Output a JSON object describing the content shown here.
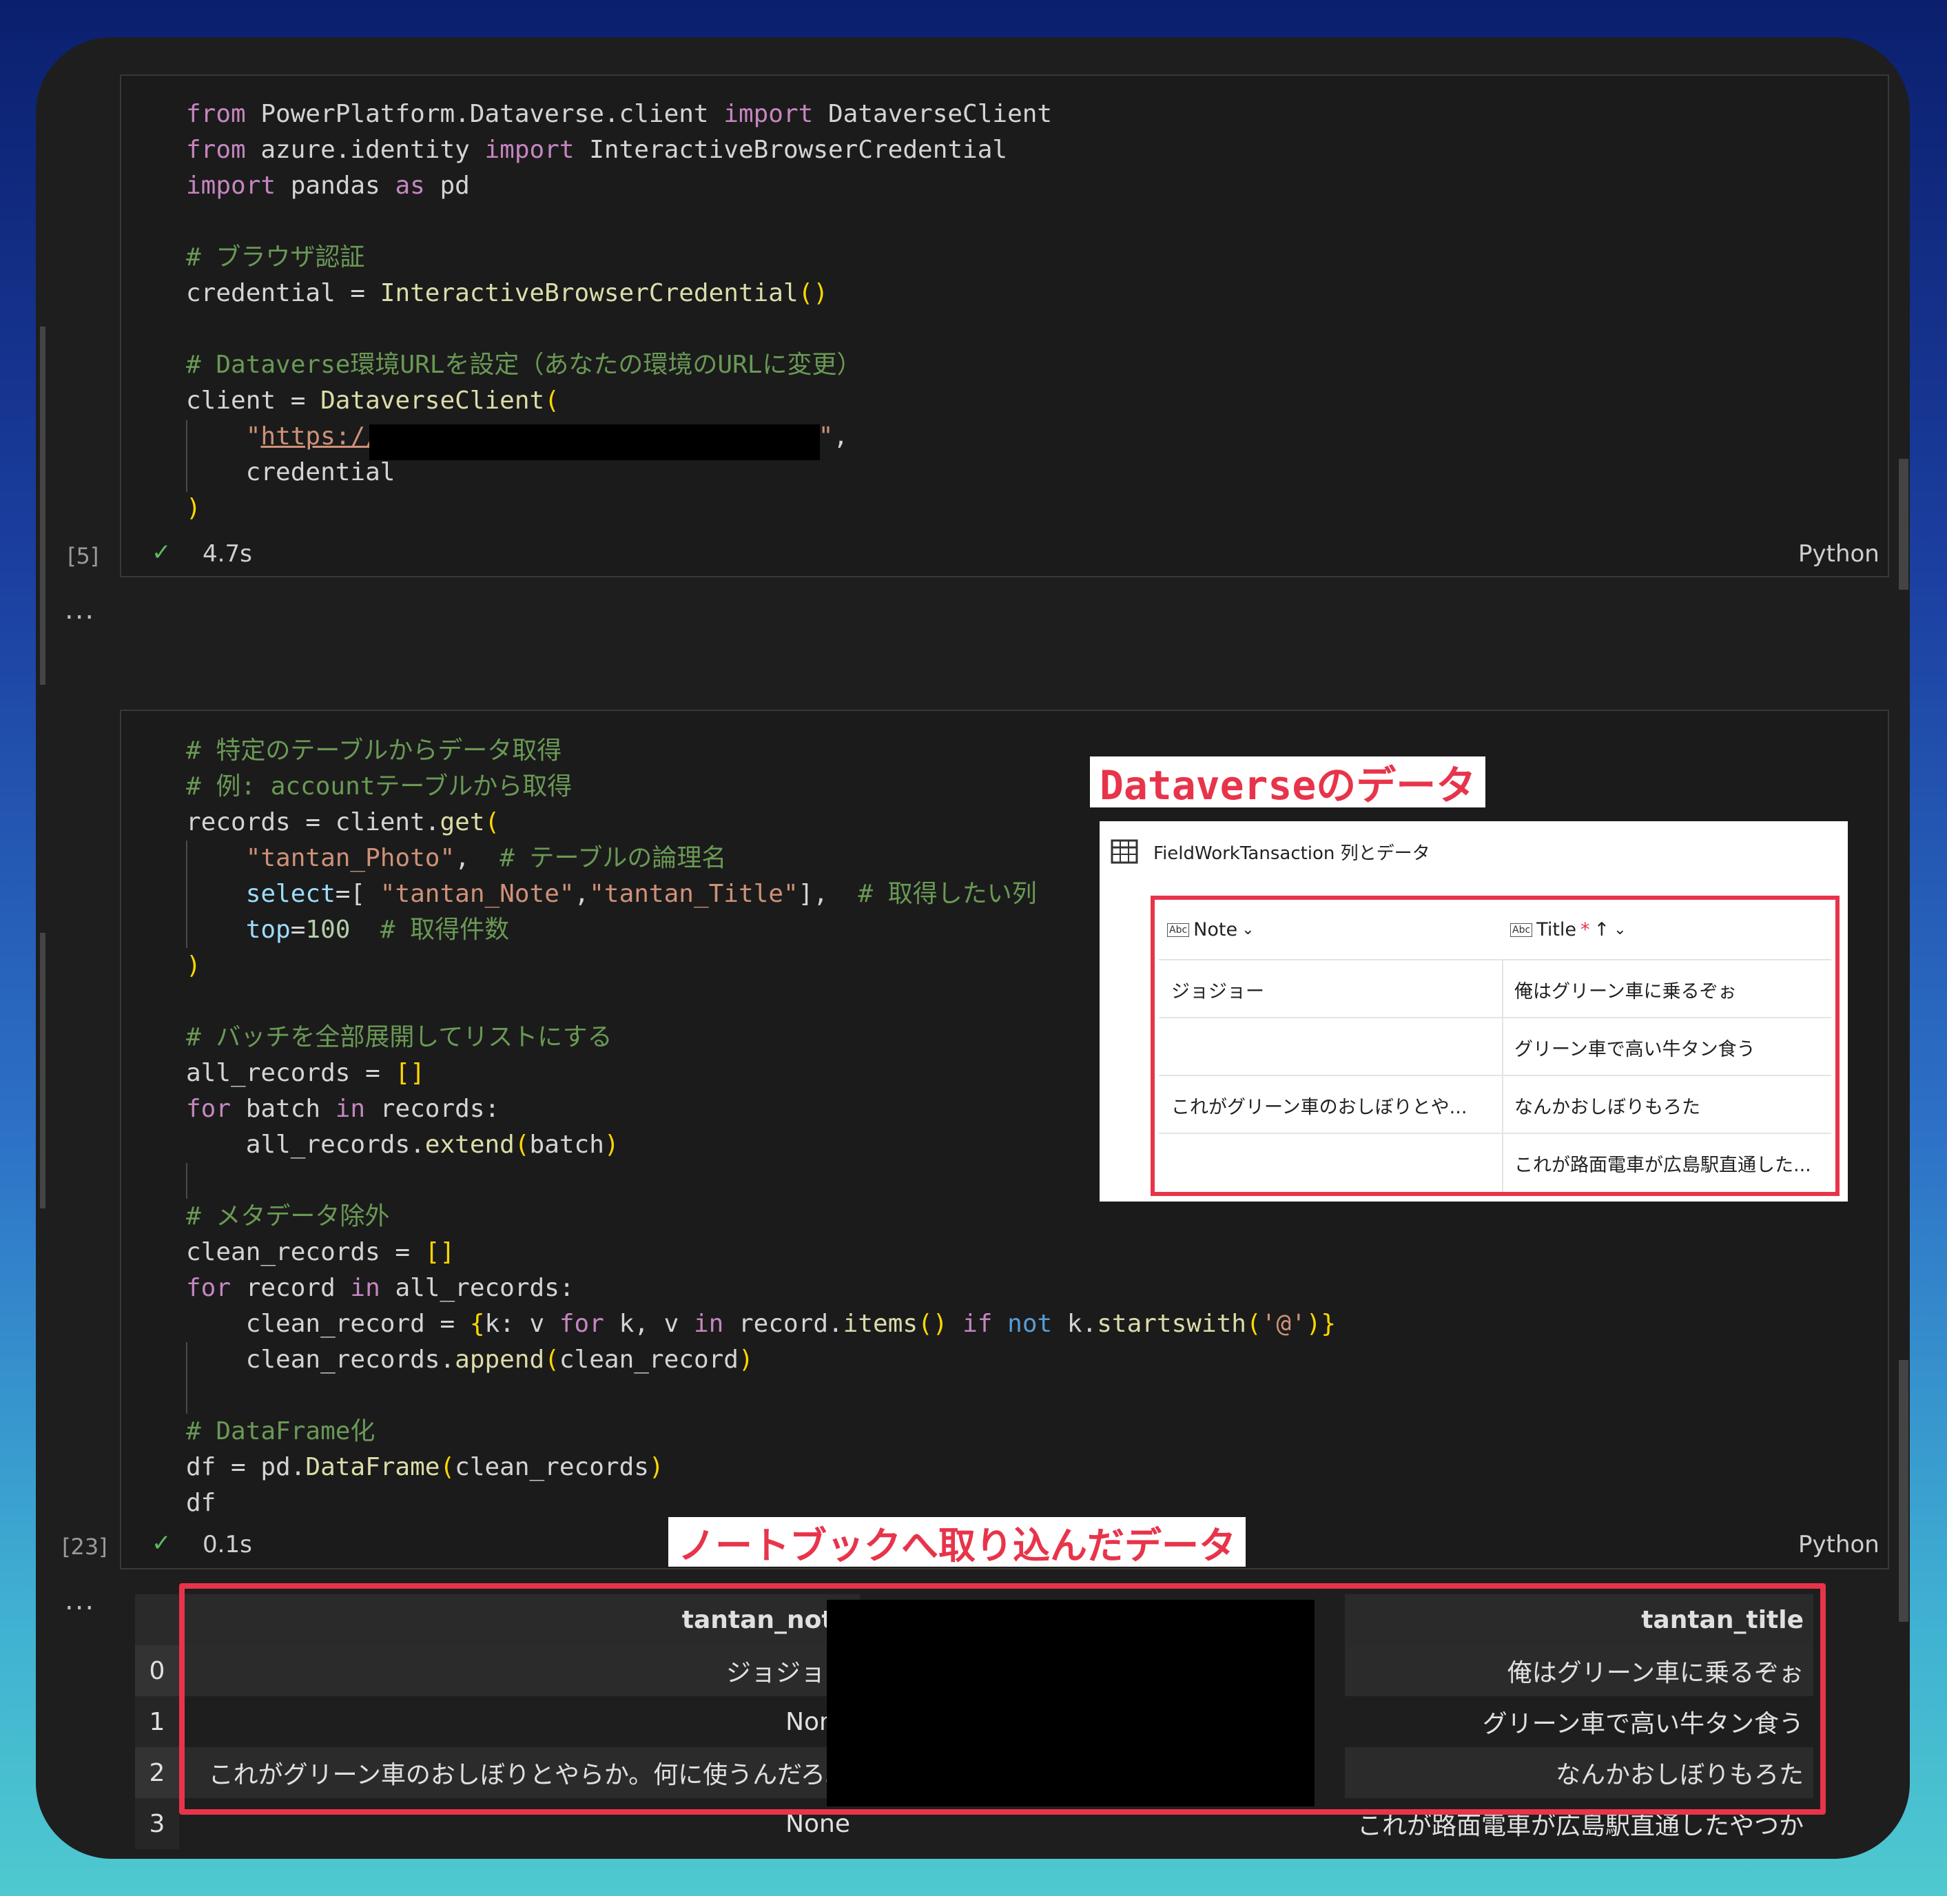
{
  "cell1": {
    "exec_count": "[5]",
    "time": "4.7s",
    "language": "Python",
    "lines": {
      "l1": {
        "k1": "from",
        "t1": " PowerPlatform.Dataverse.client ",
        "k2": "import",
        "t2": " DataverseClient"
      },
      "l2": {
        "k1": "from",
        "t1": " azure.identity ",
        "k2": "import",
        "t2": " InteractiveBrowserCredential"
      },
      "l3": {
        "k1": "import",
        "t1": " pandas ",
        "k2": "as",
        "t2": " pd"
      },
      "l5": "# ブラウザ認証",
      "l6": {
        "a": "credential = ",
        "f": "InteractiveBrowserCredential",
        "p": "()"
      },
      "l8": "# Dataverse環境URLを設定（あなたの環境のURLに変更）",
      "l9": {
        "a": "client = ",
        "f": "DataverseClient",
        "p": "("
      },
      "l10": {
        "q": "\"",
        "u": "https://",
        "q2": "\"",
        "c": ","
      },
      "l11": "credential",
      "l12": ")"
    }
  },
  "cell1_output_dots": "...",
  "cell2": {
    "exec_count": "[23]",
    "time": "0.1s",
    "language": "Python",
    "lines": {
      "l1": "# 特定のテーブルからデータ取得",
      "l2": "# 例: accountテーブルから取得",
      "l3": {
        "a": "records = client.",
        "f": "get",
        "p": "("
      },
      "l4": {
        "s": "\"tantan_Photo\"",
        "a": ",  ",
        "c": "# テーブルの論理名"
      },
      "l5": {
        "pr": "select",
        "a": "=[ ",
        "s1": "\"tantan_Note\"",
        "a2": ",",
        "s2": "\"tantan_Title\"",
        "a3": "],  ",
        "c": "# 取得したい列"
      },
      "l6": {
        "pr": "top",
        "a": "=",
        "n": "100",
        "c": "  # 取得件数"
      },
      "l7": ")",
      "l9": "# バッチを全部展開してリストにする",
      "l10": {
        "a": "all_records = ",
        "p": "[]"
      },
      "l11": {
        "k": "for",
        "a": " batch ",
        "k2": "in",
        "a2": " records:"
      },
      "l12": {
        "a": "all_records.",
        "f": "extend",
        "p1": "(",
        "b": "batch",
        "p2": ")"
      },
      "l14": "# メタデータ除外",
      "l15": {
        "a": "clean_records = ",
        "p": "[]"
      },
      "l16": {
        "k": "for",
        "a": " record ",
        "k2": "in",
        "a2": " all_records:"
      },
      "l17": {
        "a": "clean_record = ",
        "p1": "{",
        "b": "k: v ",
        "k": "for",
        "b2": " k, v ",
        "k2": "in",
        "b3": " record.",
        "f": "items",
        "p2": "()",
        "b4": " ",
        "k3": "if",
        "b5": " ",
        "k4": "not",
        "b6": " k.",
        "f2": "startswith",
        "p3": "(",
        "s": "'@'",
        "p4": ")",
        "p5": "}"
      },
      "l18": {
        "a": "clean_records.",
        "f": "append",
        "p1": "(",
        "b": "clean_record",
        "p2": ")"
      },
      "l20": "# DataFrame化",
      "l21": {
        "a": "df = pd.",
        "f": "DataFrame",
        "p1": "(",
        "b": "clean_records",
        "p2": ")"
      },
      "l22": "df"
    }
  },
  "cell2_output_dots": "...",
  "badges": {
    "dataverse": "Dataverseのデータ",
    "notebook": "ノートブックへ取り込んだデータ"
  },
  "dataverse_panel": {
    "title": "FieldWorkTansaction 列とデータ",
    "columns": {
      "note": {
        "label": "Note",
        "chevron": "⌄"
      },
      "title": {
        "label": "Title",
        "required": "*",
        "sort": "↑",
        "chevron": "⌄"
      }
    },
    "rows": [
      {
        "note": "ジョジョー",
        "title": "俺はグリーン車に乗るぞぉ"
      },
      {
        "note": "",
        "title": "グリーン車で高い牛タン食う"
      },
      {
        "note": "これがグリーン車のおしぼりとや...",
        "title": "なんかおしぼりもろた"
      },
      {
        "note": "",
        "title": "これが路面電車が広島駅直通した..."
      }
    ]
  },
  "output_table": {
    "headers": {
      "note": "tantan_note",
      "title": "tantan_title"
    },
    "rows": [
      {
        "idx": "0",
        "note": "ジョジョー",
        "title": "俺はグリーン車に乗るぞぉ"
      },
      {
        "idx": "1",
        "note": "None",
        "title": "グリーン車で高い牛タン食う"
      },
      {
        "idx": "2",
        "note": "これがグリーン車のおしぼりとやらか。何に使うんだろ。",
        "title": "なんかおしぼりもろた"
      },
      {
        "idx": "3",
        "note": "None",
        "title": "これが路面電車が広島駅直通したやつか"
      }
    ]
  },
  "colors": {
    "accent_red": "#e8344a",
    "editor_bg": "#1e1e1e",
    "keyword": "#c586c0",
    "comment": "#6a9955",
    "string": "#ce9178",
    "function": "#dcdcaa"
  }
}
